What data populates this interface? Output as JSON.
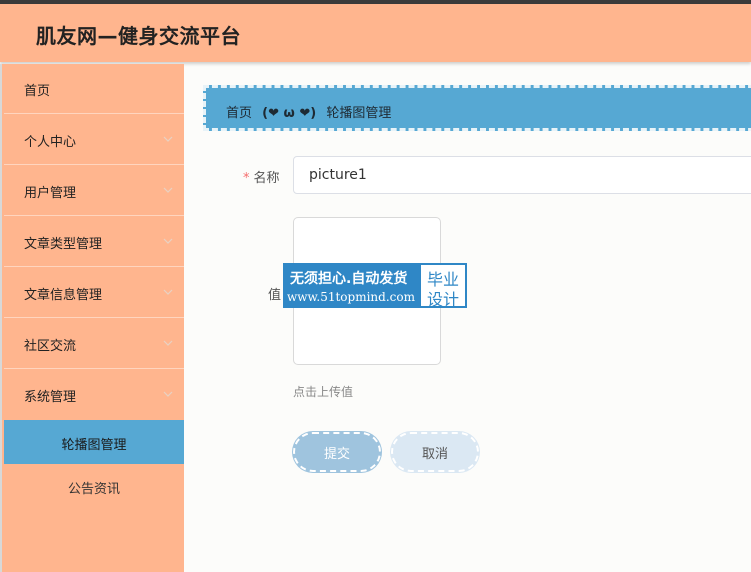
{
  "app": {
    "title": "肌友网—健身交流平台"
  },
  "sidebar": {
    "items": [
      {
        "label": "首页"
      },
      {
        "label": "个人中心"
      },
      {
        "label": "用户管理"
      },
      {
        "label": "文章类型管理"
      },
      {
        "label": "文章信息管理"
      },
      {
        "label": "社区交流"
      },
      {
        "label": "系统管理"
      }
    ],
    "sub_items": [
      {
        "label": "轮播图管理"
      },
      {
        "label": "公告资讯"
      }
    ]
  },
  "breadcrumb": {
    "home": "首页",
    "separator": "(❤ ω ❤)",
    "current": "轮播图管理"
  },
  "form": {
    "name_label": "名称",
    "required_mark": "*",
    "name_value": "picture1",
    "value_label": "值",
    "upload_tip": "点击上传值",
    "submit_label": "提交",
    "cancel_label": "取消"
  },
  "watermark": {
    "line1": "无须担心.自动发货",
    "line2": "www.51topmind.com",
    "side_line1": "毕业",
    "side_line2": "设计"
  },
  "colors": {
    "header": "#ffb58e",
    "active_menu": "#56a8d3",
    "breadcrumb": "#56a8d3",
    "submit": "#9fc4de",
    "cancel": "#dbe8f3"
  }
}
